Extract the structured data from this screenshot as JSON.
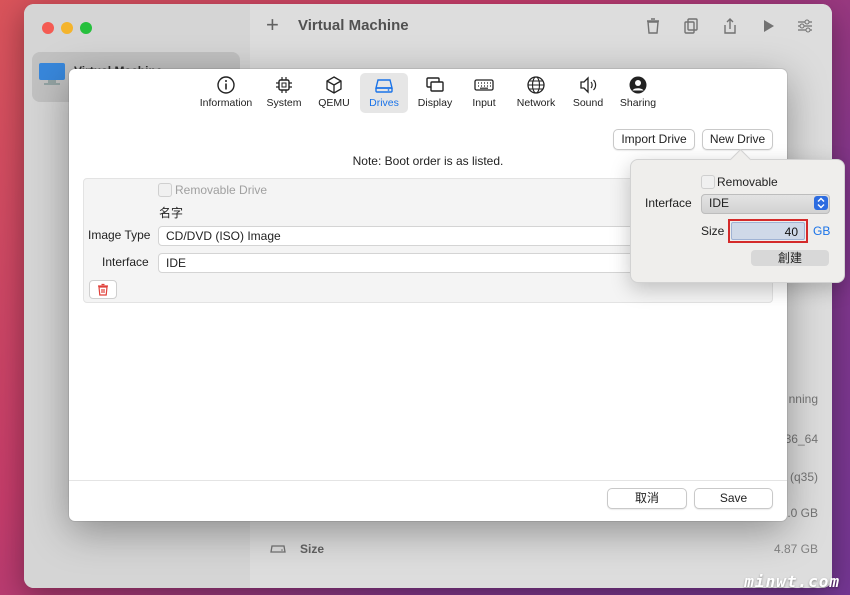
{
  "window": {
    "title": "Virtual Machine",
    "sidebar_vm_name": "Virtual Machine",
    "bg_rows": [
      "nning",
      "36_64",
      "(q35)",
      ".0 GB"
    ],
    "bg_size_label": "Size",
    "bg_size_value": "4.87 GB"
  },
  "tabs": [
    {
      "label": "Information",
      "icon": "info-icon"
    },
    {
      "label": "System",
      "icon": "chip-icon"
    },
    {
      "label": "QEMU",
      "icon": "cube-icon"
    },
    {
      "label": "Drives",
      "icon": "drive-icon",
      "active": true
    },
    {
      "label": "Display",
      "icon": "display-icon"
    },
    {
      "label": "Input",
      "icon": "keyboard-icon"
    },
    {
      "label": "Network",
      "icon": "globe-icon"
    },
    {
      "label": "Sound",
      "icon": "speaker-icon"
    },
    {
      "label": "Sharing",
      "icon": "person-icon"
    }
  ],
  "drives": {
    "import_label": "Import Drive",
    "new_label": "New Drive",
    "note": "Note: Boot order is as listed.",
    "removable_label": "Removable Drive",
    "name_label": "名字",
    "image_type_label": "Image Type",
    "image_type_value": "CD/DVD (ISO) Image",
    "interface_label": "Interface",
    "interface_value": "IDE"
  },
  "footer": {
    "cancel_label": "取消",
    "save_label": "Save"
  },
  "popover": {
    "removable_label": "Removable",
    "interface_label": "Interface",
    "interface_value": "IDE",
    "size_label": "Size",
    "size_value": "40",
    "size_unit": "GB",
    "create_label": "創建"
  },
  "watermark": "minwt.com",
  "colors": {
    "accent": "#1a73e8",
    "highlight": "#d42a2a",
    "delete": "#e0403a"
  }
}
